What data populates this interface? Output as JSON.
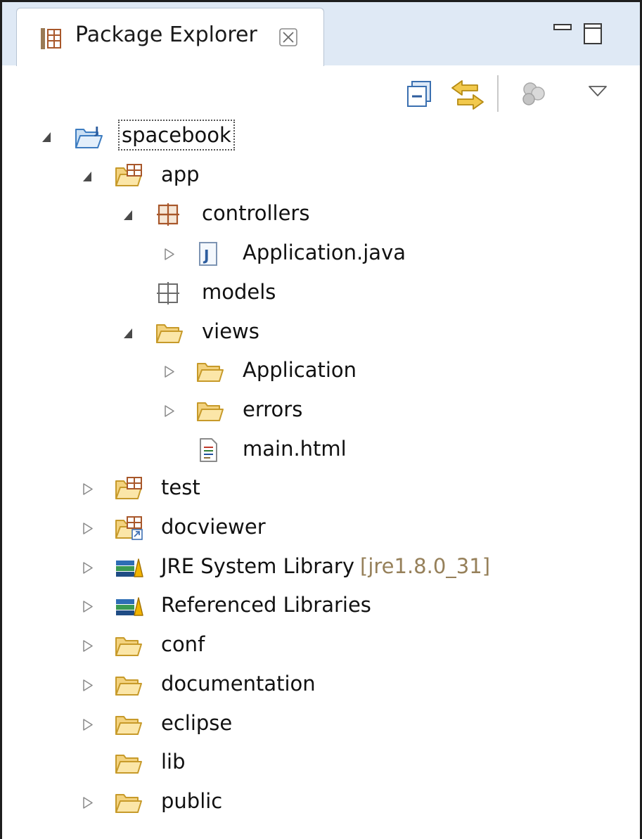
{
  "view": {
    "title": "Package Explorer",
    "close_glyph": "⊠",
    "icons": [
      "package-explorer-icon",
      "close-icon",
      "minimize-icon",
      "maximize-icon"
    ]
  },
  "toolbar": {
    "buttons": [
      "collapse-all-icon",
      "link-with-editor-icon",
      "filters-icon",
      "view-menu-icon"
    ]
  },
  "tree": {
    "items": [
      {
        "label": "spacebook",
        "decoration": "",
        "depth": 0,
        "expander": "expanded",
        "icon": "project",
        "focused": true
      },
      {
        "label": "app",
        "decoration": "",
        "depth": 1,
        "expander": "expanded",
        "icon": "source-folder"
      },
      {
        "label": "controllers",
        "decoration": "",
        "depth": 2,
        "expander": "expanded",
        "icon": "package"
      },
      {
        "label": "Application.java",
        "decoration": "",
        "depth": 3,
        "expander": "collapsed",
        "icon": "java-file"
      },
      {
        "label": "models",
        "decoration": "",
        "depth": 2,
        "expander": "none",
        "icon": "empty-package"
      },
      {
        "label": "views",
        "decoration": "",
        "depth": 2,
        "expander": "expanded",
        "icon": "folder"
      },
      {
        "label": "Application",
        "decoration": "",
        "depth": 3,
        "expander": "collapsed",
        "icon": "folder"
      },
      {
        "label": "errors",
        "decoration": "",
        "depth": 3,
        "expander": "collapsed",
        "icon": "folder"
      },
      {
        "label": "main.html",
        "decoration": "",
        "depth": 3,
        "expander": "none",
        "icon": "html-file"
      },
      {
        "label": "test",
        "decoration": "",
        "depth": 1,
        "expander": "collapsed",
        "icon": "source-folder"
      },
      {
        "label": "docviewer",
        "decoration": "",
        "depth": 1,
        "expander": "collapsed",
        "icon": "linked-source-folder"
      },
      {
        "label": "JRE System Library",
        "decoration": "[jre1.8.0_31]",
        "depth": 1,
        "expander": "collapsed",
        "icon": "library"
      },
      {
        "label": "Referenced Libraries",
        "decoration": "",
        "depth": 1,
        "expander": "collapsed",
        "icon": "library"
      },
      {
        "label": "conf",
        "decoration": "",
        "depth": 1,
        "expander": "collapsed",
        "icon": "folder"
      },
      {
        "label": "documentation",
        "decoration": "",
        "depth": 1,
        "expander": "collapsed",
        "icon": "folder"
      },
      {
        "label": "eclipse",
        "decoration": "",
        "depth": 1,
        "expander": "collapsed",
        "icon": "folder"
      },
      {
        "label": "lib",
        "decoration": "",
        "depth": 1,
        "expander": "none",
        "icon": "folder"
      },
      {
        "label": "public",
        "decoration": "",
        "depth": 1,
        "expander": "collapsed",
        "icon": "folder"
      }
    ]
  },
  "colors": {
    "tab_bar": "#dfe9f5",
    "folder": "#f3d27e",
    "folder_border": "#c79a2a",
    "decoration_text": "#96805a",
    "package_brown": "#a8572a"
  }
}
